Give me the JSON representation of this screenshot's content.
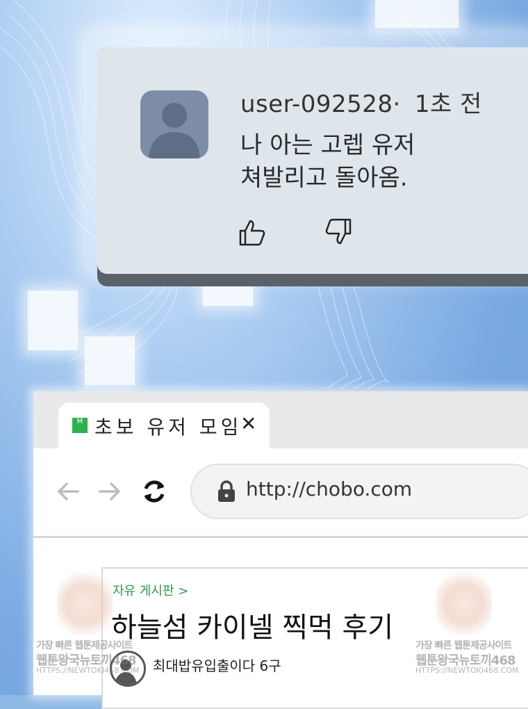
{
  "comment": {
    "username": "user-092528·",
    "time": "1초 전",
    "body_lines": [
      "나 아는 고렙 유저",
      "쳐발리고 돌아옴."
    ],
    "like_icon": "thumbs-up-icon",
    "dislike_icon": "thumbs-down-icon"
  },
  "browser": {
    "tab": {
      "favicon_letter": "M",
      "title": "초보 유저 모임",
      "close_icon": "close-icon"
    },
    "url": "http://chobo.com",
    "nav_icons": [
      "back-arrow-icon",
      "forward-arrow-icon",
      "reload-icon",
      "lock-icon"
    ]
  },
  "post": {
    "breadcrumb": "자유 게시판 >",
    "title": "하늘섬 카이넬 찍먹 후기",
    "author_line": "최대밥유입출이다  6구"
  },
  "watermark": {
    "line1": "가장 빠른 웹툰제공사이트",
    "line2": "웹툰왕국뉴토끼468",
    "line3": "HTTPS://NEWTOKI468.COM"
  },
  "colors": {
    "accent_green": "#2fb24c",
    "link_green": "#2c9a3f",
    "avatar_bg": "#7d8da6"
  }
}
